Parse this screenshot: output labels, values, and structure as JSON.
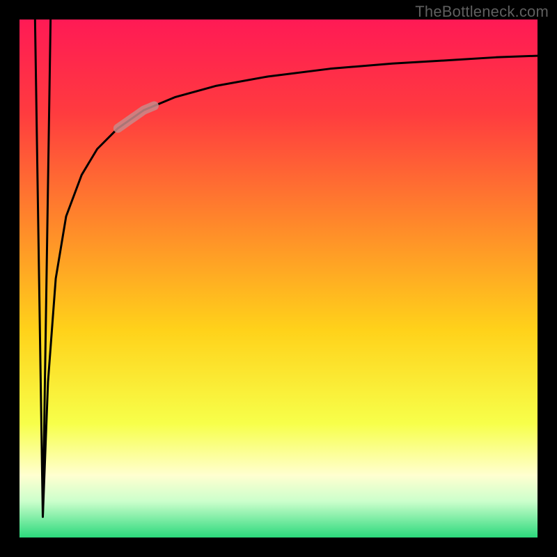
{
  "watermark": "TheBottleneck.com",
  "chart_data": {
    "type": "line",
    "title": "",
    "xlabel": "",
    "ylabel": "",
    "xlim": [
      0,
      100
    ],
    "ylim": [
      0,
      100
    ],
    "background_gradient": {
      "stops": [
        {
          "offset": 0.0,
          "color": "#ff1a55"
        },
        {
          "offset": 0.18,
          "color": "#ff3b3f"
        },
        {
          "offset": 0.4,
          "color": "#ff8a2a"
        },
        {
          "offset": 0.6,
          "color": "#ffd21a"
        },
        {
          "offset": 0.78,
          "color": "#f7ff4a"
        },
        {
          "offset": 0.88,
          "color": "#ffffd0"
        },
        {
          "offset": 0.93,
          "color": "#ccffcc"
        },
        {
          "offset": 1.0,
          "color": "#2bd97c"
        }
      ]
    },
    "series": [
      {
        "name": "spike_down",
        "x": [
          3.0,
          4.5,
          6.0
        ],
        "values": [
          100,
          4,
          100
        ]
      },
      {
        "name": "log_curve",
        "x": [
          4.5,
          5.5,
          7.0,
          9.0,
          12.0,
          15.0,
          19.0,
          24.0,
          30.0,
          38.0,
          48.0,
          60.0,
          72.0,
          84.0,
          92.0,
          100.0
        ],
        "values": [
          4,
          30,
          50,
          62,
          70,
          75,
          79,
          82.5,
          85,
          87.2,
          89,
          90.5,
          91.5,
          92.2,
          92.7,
          93.0
        ]
      }
    ],
    "highlight_segment": {
      "on_series": "log_curve",
      "x_range": [
        19,
        26
      ],
      "color": "#c98a8a",
      "width": 13
    },
    "frame": {
      "stroke": "#000000",
      "stroke_width": 28
    }
  }
}
